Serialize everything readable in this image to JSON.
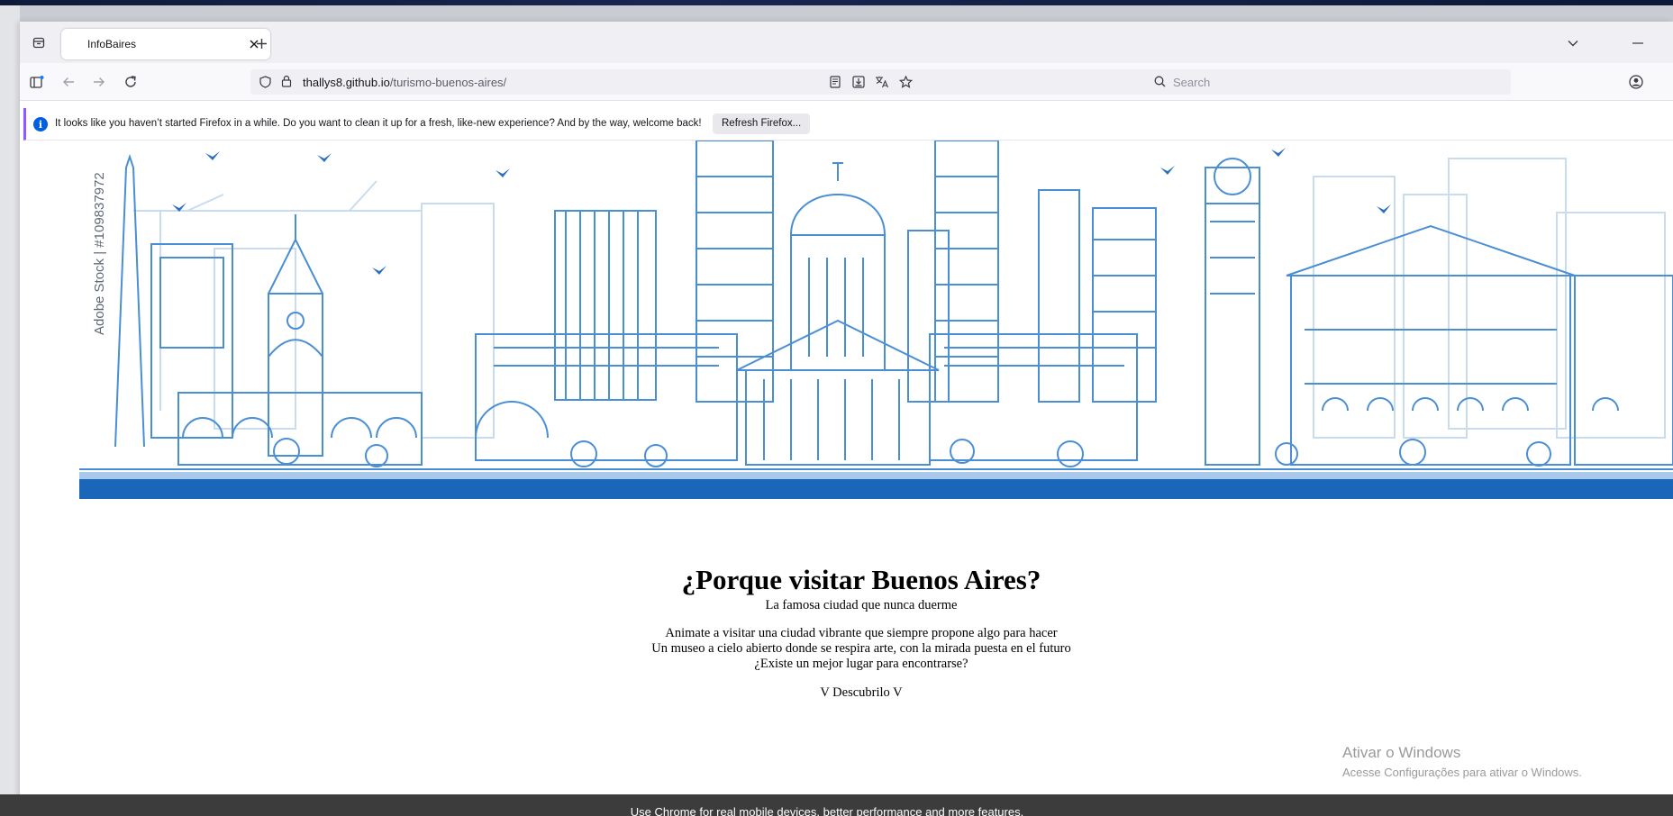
{
  "browser": {
    "tab_title": "InfoBaires",
    "url_host": "thallys8.github.io",
    "url_path": "/turismo-buenos-aires/",
    "search_placeholder": "Search"
  },
  "notification": {
    "message": "It looks like you haven’t started Firefox in a while. Do you want to clean it up for a fresh, like-new experience? And by the way, welcome back!",
    "button": "Refresh Firefox..."
  },
  "page": {
    "watermark": "Adobe Stock | #109837972",
    "heading": "¿Porque visitar Buenos Aires?",
    "subtitle": "La famosa ciudad que nunca duerme",
    "lines": [
      "Animate a visitar una ciudad vibrante que siempre propone algo para hacer",
      "Un museo a cielo abierto donde se respira arte, con la mirada puesta en el futuro",
      "¿Existe un mejor lugar para encontrarse?"
    ],
    "cta": "V Descubrilo V"
  },
  "os_overlay": {
    "title": "Ativar o Windows",
    "subtitle": "Acesse Configurações para ativar o Windows."
  },
  "bottom_bar": "Use Chrome for real mobile devices, better performance and more features.",
  "colors": {
    "skyline_stroke": "#4a8fd6",
    "skyline_light": "#c9dcef",
    "skyline_base": "#1a66b8",
    "accent_purple": "#9059ff"
  },
  "icons": [
    "tab-list-icon",
    "close-icon",
    "plus-icon",
    "chevron-down-icon",
    "minimize-icon",
    "sidebar-icon",
    "back-icon",
    "forward-icon",
    "reload-icon",
    "shield-icon",
    "lock-icon",
    "reader-view-icon",
    "save-icon",
    "translate-icon",
    "star-icon",
    "search-icon",
    "account-icon",
    "info-icon"
  ]
}
